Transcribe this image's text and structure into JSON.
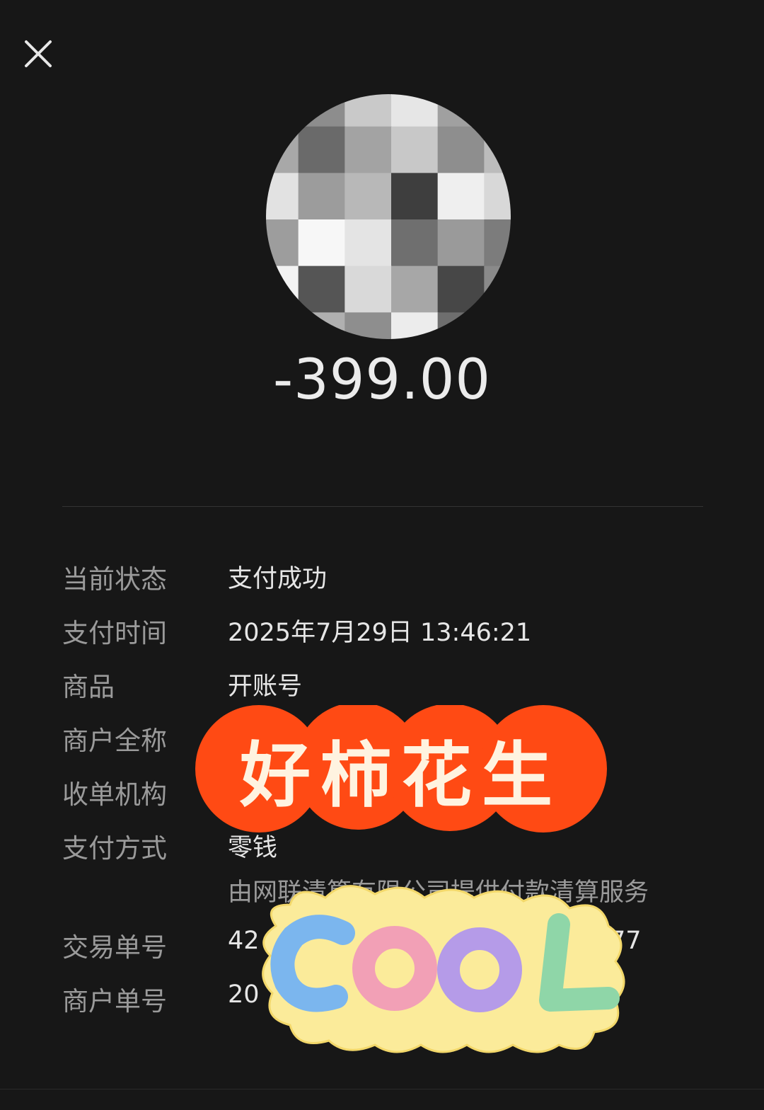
{
  "header": {
    "close_icon": "close-icon"
  },
  "transaction": {
    "amount": "-399.00"
  },
  "details": {
    "rows": [
      {
        "label": "当前状态",
        "value": "支付成功"
      },
      {
        "label": "支付时间",
        "value": "2025年7月29日 13:46:21"
      },
      {
        "label": "商品",
        "value": "开账号"
      },
      {
        "label": "商户全称",
        "value": ""
      },
      {
        "label": "收单机构",
        "value": ""
      },
      {
        "label": "支付方式",
        "value": "零钱"
      },
      {
        "label": "",
        "value": "由网联清算有限公司提供付款清算服务"
      },
      {
        "label": "交易单号",
        "value": "42",
        "value_tail": "77"
      },
      {
        "label": "商户单号",
        "value": "20"
      }
    ]
  },
  "stickers": {
    "peanut_text": "好柿花生",
    "cool_text": "COOL"
  },
  "colors": {
    "background": "#171717",
    "amount": "#ececec",
    "label": "#9a9a9a",
    "value": "#e6e6e6",
    "sticker_orange": "#ff4a14",
    "sticker_yellow": "#fbeb9a"
  }
}
